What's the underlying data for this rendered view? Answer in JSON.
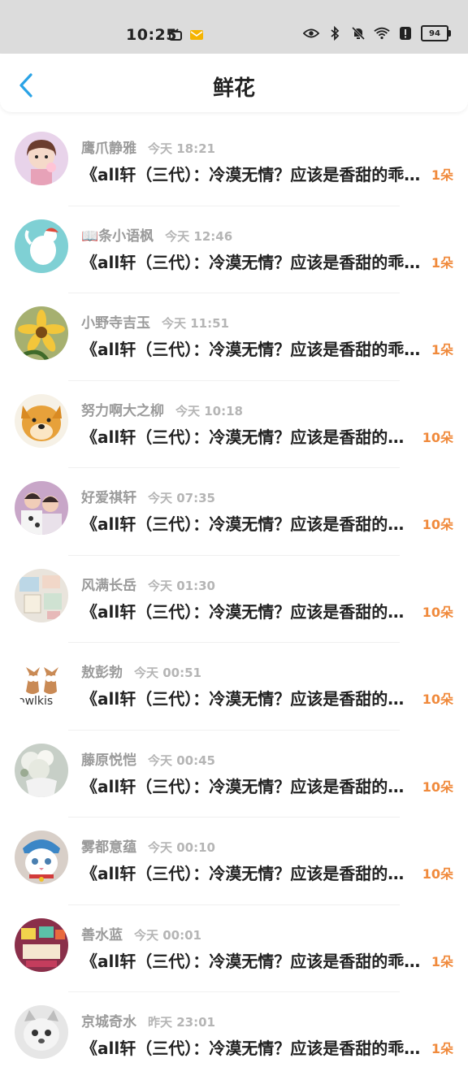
{
  "status_bar": {
    "time": "10:25",
    "battery": "94"
  },
  "header": {
    "title": "鲜花"
  },
  "items": [
    {
      "name": "鹰爪静雅",
      "time": "今天  18:21",
      "title": "《all轩（三代）：冷漠无情？应该是香甜的乖宝宝",
      "count": "1朵"
    },
    {
      "name": "📖条小语枫",
      "time": "今天  12:46",
      "title": "《all轩（三代）：冷漠无情？应该是香甜的乖宝宝",
      "count": "1朵"
    },
    {
      "name": "小野寺吉玉",
      "time": "今天  11:51",
      "title": "《all轩（三代）：冷漠无情？应该是香甜的乖宝宝",
      "count": "1朵"
    },
    {
      "name": "努力啊大之柳",
      "time": "今天  10:18",
      "title": "《all轩（三代）：冷漠无情？应该是香甜的乖宝宝",
      "count": "10朵"
    },
    {
      "name": "好爱祺轩",
      "time": "今天  07:35",
      "title": "《all轩（三代）：冷漠无情？应该是香甜的乖宝宝",
      "count": "10朵"
    },
    {
      "name": "风满长岳",
      "time": "今天  01:30",
      "title": "《all轩（三代）：冷漠无情？应该是香甜的乖宝宝",
      "count": "10朵"
    },
    {
      "name": "敖彭勃",
      "time": "今天  00:51",
      "title": "《all轩（三代）：冷漠无情？应该是香甜的乖宝宝",
      "count": "10朵"
    },
    {
      "name": "藤原悦恺",
      "time": "今天  00:45",
      "title": "《all轩（三代）：冷漠无情？应该是香甜的乖宝宝",
      "count": "10朵"
    },
    {
      "name": "雾都意蕴",
      "time": "今天  00:10",
      "title": "《all轩（三代）：冷漠无情？应该是香甜的乖宝宝",
      "count": "10朵"
    },
    {
      "name": "善水蓝",
      "time": "今天  00:01",
      "title": "《all轩（三代）：冷漠无情？应该是香甜的乖宝宝",
      "count": "1朵"
    },
    {
      "name": "京城奇水",
      "time": "昨天  23:01",
      "title": "《all轩（三代）：冷漠无情？应该是香甜的乖宝宝",
      "count": "1朵"
    }
  ],
  "colors": {
    "accent": "#2aa3e6",
    "count": "#f08a3c"
  },
  "icons": [
    "back-arrow-icon",
    "eye-icon",
    "bluetooth-icon",
    "mute-icon",
    "wifi-icon",
    "battery-icon"
  ]
}
